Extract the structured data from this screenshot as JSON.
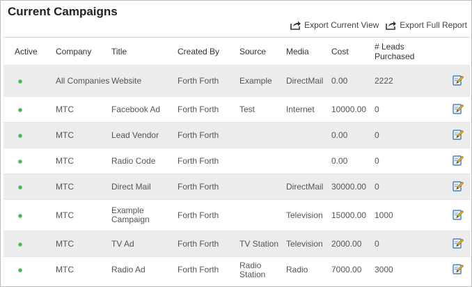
{
  "page": {
    "title": "Current Campaigns"
  },
  "toolbar": {
    "export_current_label": "Export Current View",
    "export_full_label": "Export Full Report",
    "export_icon": "share-export-icon"
  },
  "table": {
    "columns": [
      "Active",
      "Company",
      "Title",
      "Created By",
      "Source",
      "Media",
      "Cost",
      "# Leads Purchased"
    ],
    "edit_icon": "edit-pencil-icon",
    "active_color": "#4cae4c",
    "rows": [
      {
        "active": true,
        "company": "All Companies",
        "title": "Website",
        "created_by": "Forth Forth",
        "source": "Example",
        "media": "DirectMail",
        "cost": "0.00",
        "leads": "2222"
      },
      {
        "active": true,
        "company": "MTC",
        "title": "Facebook Ad",
        "created_by": "Forth Forth",
        "source": "Test",
        "media": "Internet",
        "cost": "10000.00",
        "leads": "0"
      },
      {
        "active": true,
        "company": "MTC",
        "title": "Lead Vendor",
        "created_by": "Forth Forth",
        "source": "",
        "media": "",
        "cost": "0.00",
        "leads": "0"
      },
      {
        "active": true,
        "company": "MTC",
        "title": "Radio Code",
        "created_by": "Forth Forth",
        "source": "",
        "media": "",
        "cost": "0.00",
        "leads": "0"
      },
      {
        "active": true,
        "company": "MTC",
        "title": "Direct Mail",
        "created_by": "Forth Forth",
        "source": "",
        "media": "DirectMail",
        "cost": "30000.00",
        "leads": "0"
      },
      {
        "active": true,
        "company": "MTC",
        "title": "Example Campaign",
        "created_by": "Forth Forth",
        "source": "",
        "media": "Television",
        "cost": "15000.00",
        "leads": "1000"
      },
      {
        "active": true,
        "company": "MTC",
        "title": "TV Ad",
        "created_by": "Forth Forth",
        "source": "TV Station",
        "media": "Television",
        "cost": "2000.00",
        "leads": "0"
      },
      {
        "active": true,
        "company": "MTC",
        "title": "Radio Ad",
        "created_by": "Forth Forth",
        "source": "Radio Station",
        "media": "Radio",
        "cost": "7000.00",
        "leads": "3000"
      }
    ]
  }
}
